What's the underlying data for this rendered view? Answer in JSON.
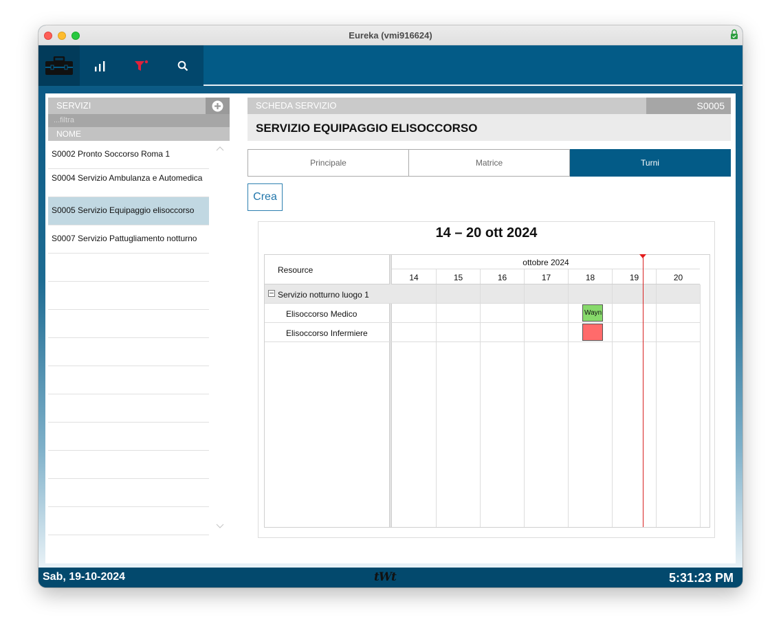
{
  "window": {
    "title": "Eureka (vmi916624)"
  },
  "nav": {
    "icons": [
      "toolbox-icon",
      "bar-chart-icon",
      "filter-icon",
      "search-icon"
    ]
  },
  "sidebar": {
    "title": "SERVIZI",
    "filter_placeholder": "...filtra",
    "column": "NOME",
    "items": [
      {
        "label": "S0002 Pronto Soccorso Roma 1",
        "selected": false
      },
      {
        "label": "S0004 Servizio Ambulanza e Automedica",
        "selected": false
      },
      {
        "label": "S0005 Servizio Equipaggio elisoccorso",
        "selected": true
      },
      {
        "label": "S0007 Servizio Pattugliamento notturno",
        "selected": false
      }
    ]
  },
  "sheet": {
    "label": "SCHEDA  SERVIZIO",
    "code": "S0005",
    "title": "SERVIZIO EQUIPAGGIO ELISOCCORSO"
  },
  "tabs": [
    {
      "label": "Principale",
      "active": false
    },
    {
      "label": "Matrice",
      "active": false
    },
    {
      "label": "Turni",
      "active": true
    }
  ],
  "actions": {
    "crea": "Crea"
  },
  "calendar": {
    "title": "14 – 20 ott 2024",
    "resource_header": "Resource",
    "month": "ottobre 2024",
    "days": [
      "14",
      "15",
      "16",
      "17",
      "18",
      "19",
      "20"
    ],
    "group": "Servizio notturno luogo 1",
    "resources": [
      "Elisoccorso Medico",
      "Elisoccorso Infermiere"
    ],
    "events": [
      {
        "resource": "Elisoccorso Medico",
        "day": "18",
        "text": "Wayn",
        "color": "#87d96b"
      },
      {
        "resource": "Elisoccorso Infermiere",
        "day": "18",
        "text": "",
        "color": "#ff6b6b"
      }
    ],
    "now_color": "#e31b1b"
  },
  "footer": {
    "date": "Sab, 19-10-2024",
    "logo": "tWt",
    "time": "5:31:23 PM"
  },
  "colors": {
    "primary": "#035b87",
    "selected_row": "#c1d8e2"
  }
}
